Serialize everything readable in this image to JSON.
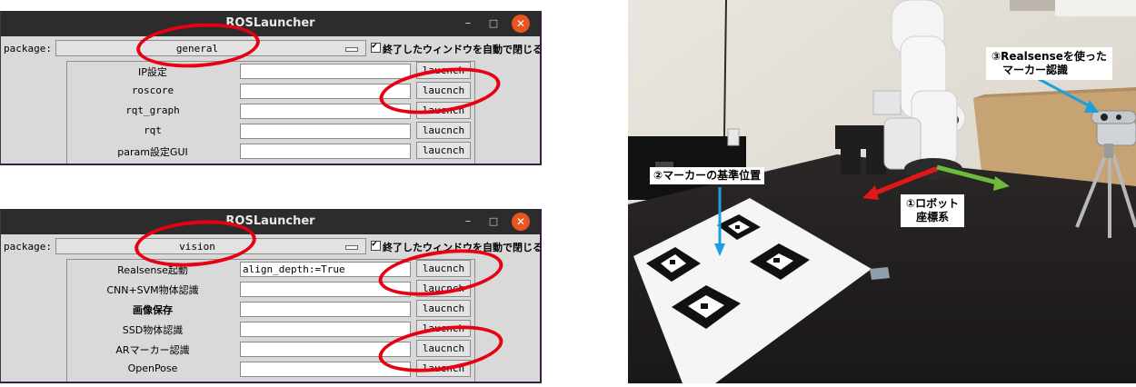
{
  "windows": [
    {
      "title": "ROSLauncher",
      "package_label": "package:",
      "package_value": "general",
      "checkbox_label": "終了したウィンドウを自動で閉じる",
      "rows": [
        {
          "name": "IP設定",
          "value": "",
          "button": "laucnch"
        },
        {
          "name": "roscore",
          "value": "",
          "button": "laucnch"
        },
        {
          "name": "rqt_graph",
          "value": "",
          "button": "laucnch"
        },
        {
          "name": "rqt",
          "value": "",
          "button": "laucnch"
        },
        {
          "name": "param設定GUI",
          "value": "",
          "button": "laucnch"
        }
      ]
    },
    {
      "title": "ROSLauncher",
      "package_label": "package:",
      "package_value": "vision",
      "checkbox_label": "終了したウィンドウを自動で閉じる",
      "rows": [
        {
          "name": "Realsense起動",
          "value": "align_depth:=True",
          "button": "laucnch"
        },
        {
          "name": "CNN+SVM物体認識",
          "value": "",
          "button": "laucnch"
        },
        {
          "name": "画像保存",
          "value": "",
          "button": "laucnch"
        },
        {
          "name": "SSD物体認識",
          "value": "",
          "button": "laucnch"
        },
        {
          "name": "ARマーカー認識",
          "value": "",
          "button": "laucnch"
        },
        {
          "name": "OpenPose",
          "value": "",
          "button": "laucnch"
        }
      ]
    }
  ],
  "window_controls": {
    "minimize": "–",
    "maximize": "□",
    "close": "✕"
  },
  "photo": {
    "callouts": {
      "marker_base": "②マーカーの基準位置",
      "robot_frame_1": "①ロボット",
      "robot_frame_2": "座標系",
      "realsense_1": "③Realsenseを使った",
      "realsense_2": "マーカー認識"
    }
  },
  "colors": {
    "annotation_red": "#e60012",
    "pointer_blue": "#1aa0e0",
    "axis_red": "#e01818",
    "axis_green": "#6dbb3b",
    "titlebar": "#2c2c2c",
    "close_button": "#e95420"
  }
}
